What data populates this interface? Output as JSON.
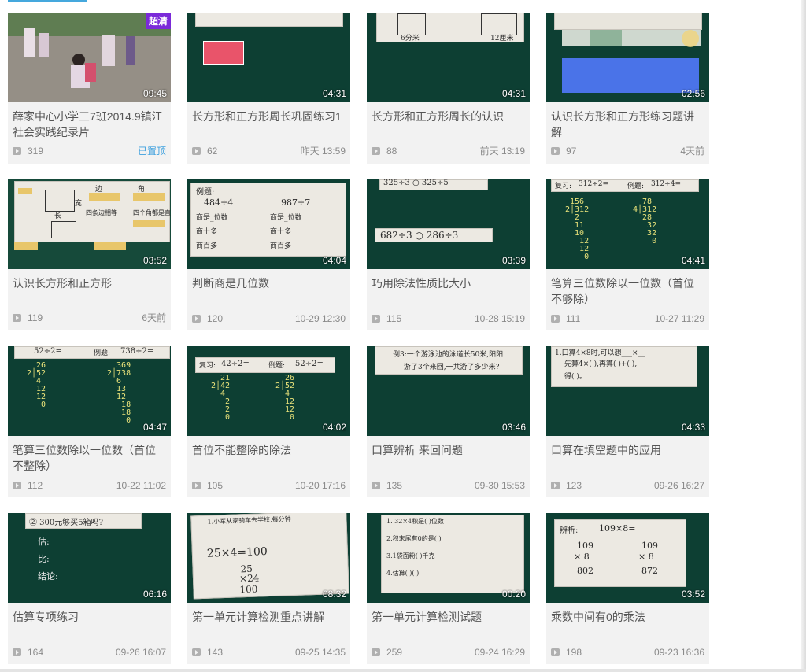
{
  "videos": [
    {
      "title": "薛家中心小学三7班2014.9镇江社会实践纪录片",
      "duration": "09:45",
      "views": "319",
      "date": "已置顶",
      "badge": "超清"
    },
    {
      "title": "长方形和正方形周长巩固练习1",
      "duration": "04:31",
      "views": "62",
      "date": "昨天 13:59"
    },
    {
      "title": "长方形和正方形周长的认识",
      "duration": "04:31",
      "views": "88",
      "date": "前天 13:19"
    },
    {
      "title": "认识长方形和正方形练习题讲解",
      "duration": "02:56",
      "views": "97",
      "date": "4天前"
    },
    {
      "title": "认识长方形和正方形",
      "duration": "03:52",
      "views": "119",
      "date": "6天前"
    },
    {
      "title": "判断商是几位数",
      "duration": "04:04",
      "views": "120",
      "date": "10-29 12:30"
    },
    {
      "title": "巧用除法性质比大小",
      "duration": "03:39",
      "views": "115",
      "date": "10-28 15:19"
    },
    {
      "title": "笔算三位数除以一位数（首位不够除）",
      "duration": "04:41",
      "views": "111",
      "date": "10-27 11:29"
    },
    {
      "title": "笔算三位数除以一位数（首位不整除）",
      "duration": "04:47",
      "views": "112",
      "date": "10-22 11:02"
    },
    {
      "title": "首位不能整除的除法",
      "duration": "04:02",
      "views": "105",
      "date": "10-20 17:16"
    },
    {
      "title": "口算辨析 来回问题",
      "duration": "03:46",
      "views": "135",
      "date": "09-30 15:53"
    },
    {
      "title": "口算在填空题中的应用",
      "duration": "04:33",
      "views": "123",
      "date": "09-26 16:27"
    },
    {
      "title": "估算专项练习",
      "duration": "06:16",
      "views": "164",
      "date": "09-26 16:07"
    },
    {
      "title": "第一单元计算检测重点讲解",
      "duration": "08:32",
      "views": "143",
      "date": "09-25 14:35"
    },
    {
      "title": "第一单元计算检测试题",
      "duration": "00:20",
      "views": "259",
      "date": "09-24 16:29"
    },
    {
      "title": "乘数中间有0的乘法",
      "duration": "03:52",
      "views": "198",
      "date": "09-23 16:36"
    }
  ],
  "thumb_text": {
    "t2_l": "6分米",
    "t2_r": "12厘米",
    "t5_a": "边",
    "t5_b": "角",
    "t5_c": "长",
    "t5_d": "宽",
    "t5_e": "长",
    "t5_f": "四条边相等",
    "t5_g": "四个角都是直角",
    "t6_a": "例题:",
    "t6_b": "484÷4",
    "t6_c": "987÷7",
    "t6_d": "商是_位数",
    "t6_e": "商是_位数",
    "t6_f": "商十多",
    "t6_g": "商十多",
    "t6_h": "商百多",
    "t6_i": "商百多",
    "t7_top": "325÷3 ○ 325÷5",
    "t7_main": "682÷3 ○ 286÷3",
    "t8_a": "复习:",
    "t8_b": "312÷2=",
    "t8_c": "例题:",
    "t8_d": "312÷4=",
    "t9_a": "52÷2=",
    "t9_b": "例题:",
    "t9_c": "738÷2=",
    "t10_a": "复习:",
    "t10_b": "42÷2=",
    "t10_c": "例题:",
    "t10_d": "52÷2=",
    "t11_a": "例3:一个游泳池的泳道长50米,阳阳",
    "t11_b": "游了3个来回,一共游了多少米?",
    "t12_a": "1.口算4×8时,可以想___×__",
    "t12_b": "先算4×( ),再算( )+( ),",
    "t12_c": "得( )。",
    "t13_a": "② 300元够买5箱吗?",
    "t13_b": "估:",
    "t13_c": "比:",
    "t13_d": "结论:",
    "t14_a": "1.小军从家骑车去学校,每分钟",
    "t14_b": "25×4=100",
    "t14_c": "25",
    "t14_d": "×24",
    "t14_e": "100",
    "t15_a": "1. 32×4积是( )位数",
    "t15_b": "2.积末尾有0的是( )",
    "t15_c": "3.1袋面粉( )千克",
    "t15_d": "4.估算( )( )",
    "t16_a": "辨析:",
    "t16_b": "109×8=",
    "t16_c": "109",
    "t16_d": "×  8",
    "t16_e": "802",
    "t16_f": "109",
    "t16_g": "×  8",
    "t16_h": "872"
  }
}
